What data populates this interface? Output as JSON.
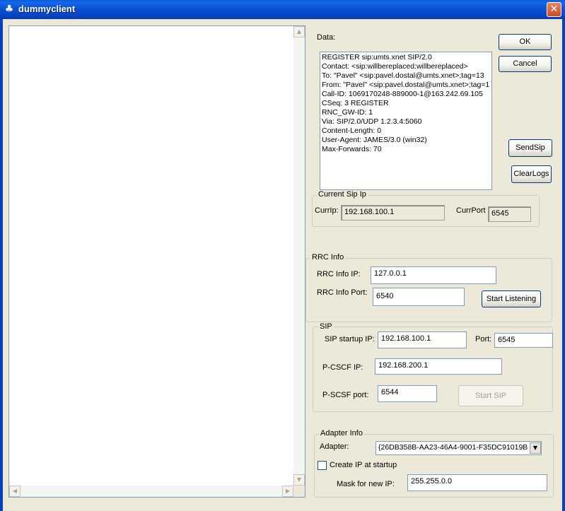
{
  "window": {
    "title": "dummyclient",
    "close_glyph": "✕",
    "icon": "app-icon"
  },
  "log_panel": {
    "content": ""
  },
  "data": {
    "label": "Data:",
    "lines": [
      "REGISTER sip:umts.xnet SIP/2.0",
      "Contact: <sip:willbereplaced:willbereplaced>",
      "To: \"Pavel\" <sip:pavel.dostal@umts.xnet>;tag=13",
      "From: \"Pavel\" <sip:pavel.dostal@umts.xnet>;tag=1",
      "Call-ID: 1069170248-889000-1@163.242.69.105",
      "CSeq: 3 REGISTER",
      "RNC_GW-ID: 1",
      "Via: SIP/2.0/UDP 1.2.3.4:5060",
      "Content-Length: 0",
      "User-Agent: JAMES/3.0 (win32)",
      "Max-Forwards: 70"
    ]
  },
  "buttons": {
    "ok": "OK",
    "cancel": "Cancel",
    "send_sip": "SendSip",
    "clear_logs": "ClearLogs",
    "start_listening": "Start Listening",
    "start_sip": "Start SIP"
  },
  "current_sip": {
    "legend": "Current Sip Ip",
    "curr_ip_label": "CurrIp:",
    "curr_ip_value": "192.168.100.1",
    "curr_port_label": "CurrPort",
    "curr_port_value": "6545"
  },
  "rrc": {
    "legend": "RRC Info",
    "ip_label": "RRC Info IP:",
    "ip_value": "127.0.0.1",
    "port_label": "RRC Info Port:",
    "port_value": "6540"
  },
  "sip": {
    "legend": "SIP",
    "startup_ip_label": "SIP startup IP:",
    "startup_ip_value": "192.168.100.1",
    "port_label": "Port:",
    "port_value": "6545",
    "pcscf_ip_label": "P-CSCF IP:",
    "pcscf_ip_value": "192.168.200.1",
    "pscsf_port_label": "P-SCSF port:",
    "pscsf_port_value": "6544"
  },
  "adapter": {
    "legend": "Adapter Info",
    "adapter_label": "Adapter:",
    "adapter_value": "{26DB358B-AA23-46A4-9001-F35DC91019B",
    "create_ip_label": "Create IP at startup",
    "create_ip_checked": false,
    "mask_label": "Mask for new IP:",
    "mask_value": "255.255.0.0"
  }
}
